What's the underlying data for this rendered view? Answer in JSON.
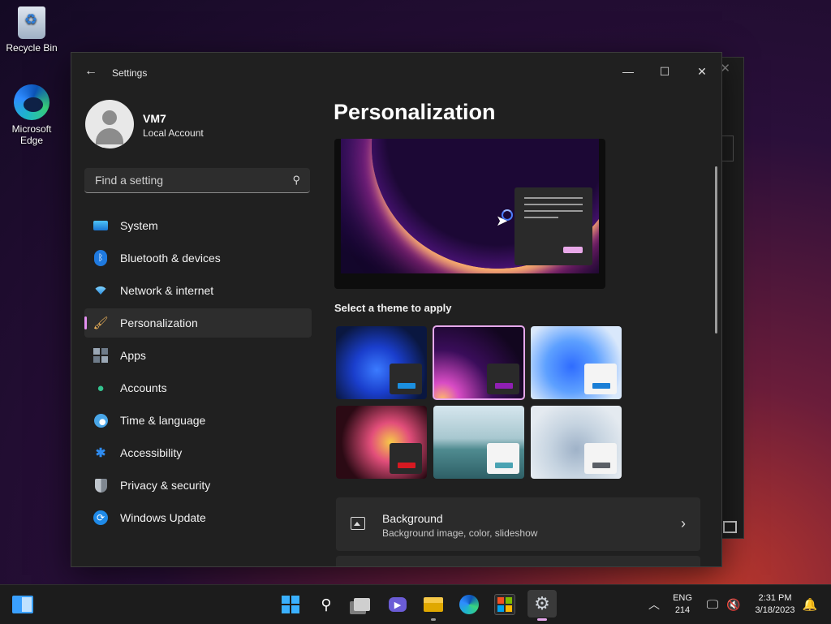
{
  "desktop": {
    "icons": [
      {
        "label": "Recycle Bin"
      },
      {
        "label_line1": "Microsoft",
        "label_line2": "Edge"
      }
    ]
  },
  "window": {
    "app_title": "Settings",
    "back_icon": "arrow-left-icon",
    "controls": {
      "minimize": "—",
      "maximize": "☐",
      "close": "✕"
    }
  },
  "account": {
    "name": "VM7",
    "type": "Local Account"
  },
  "search": {
    "placeholder": "Find a setting",
    "icon": "search-icon"
  },
  "nav": {
    "items": [
      {
        "label": "System",
        "icon": "system-icon"
      },
      {
        "label": "Bluetooth & devices",
        "icon": "bluetooth-icon"
      },
      {
        "label": "Network & internet",
        "icon": "wifi-icon"
      },
      {
        "label": "Personalization",
        "icon": "brush-icon",
        "active": true
      },
      {
        "label": "Apps",
        "icon": "apps-icon"
      },
      {
        "label": "Accounts",
        "icon": "person-icon"
      },
      {
        "label": "Time & language",
        "icon": "globe-clock-icon"
      },
      {
        "label": "Accessibility",
        "icon": "accessibility-icon"
      },
      {
        "label": "Privacy & security",
        "icon": "shield-icon"
      },
      {
        "label": "Windows Update",
        "icon": "update-icon"
      }
    ]
  },
  "main": {
    "title": "Personalization",
    "themes_heading": "Select a theme to apply",
    "themes": [
      {
        "name": "theme-windows-light-blue"
      },
      {
        "name": "theme-windows-dark",
        "selected": true
      },
      {
        "name": "theme-windows-light"
      },
      {
        "name": "theme-glow"
      },
      {
        "name": "theme-captured-motion"
      },
      {
        "name": "theme-flow"
      }
    ],
    "cards": [
      {
        "title": "Background",
        "subtitle": "Background image, color, slideshow",
        "icon": "image-icon"
      }
    ]
  },
  "taskbar": {
    "tray": {
      "language": "ENG",
      "language_sub": "214",
      "time": "2:31 PM",
      "date": "3/18/2023"
    }
  },
  "colors": {
    "accent": "#e6a8ec",
    "window_bg": "#202020",
    "card_bg": "#2b2b2b"
  }
}
